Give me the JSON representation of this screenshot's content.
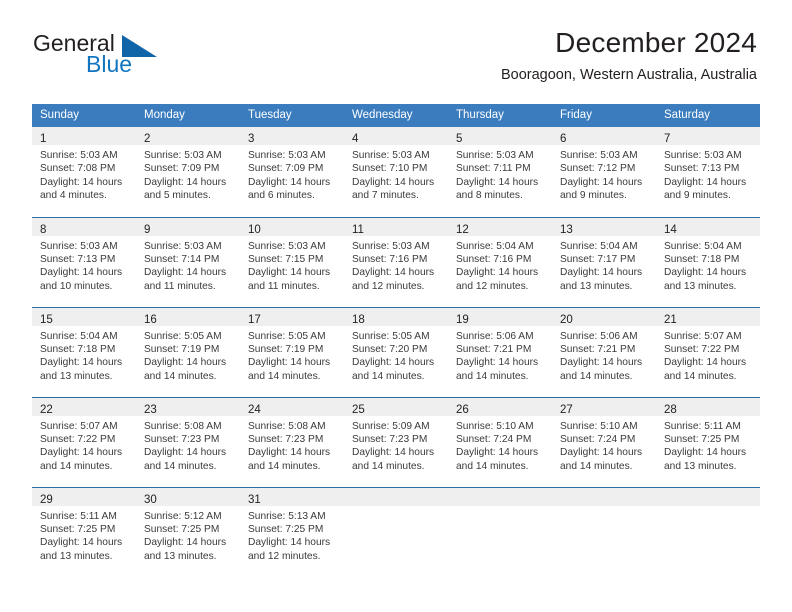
{
  "logo": {
    "word1": "General",
    "word2": "Blue",
    "triangle_color": "#1064a8",
    "blue_color": "#1175c0"
  },
  "header": {
    "title": "December 2024",
    "subtitle": "Booragoon, Western Australia, Australia"
  },
  "theme": {
    "header_blue": "#3a7cbe",
    "row_line": "#2e6ea8",
    "daynum_band": "#efefef",
    "text": "#231f20"
  },
  "weekday_headers": [
    "Sunday",
    "Monday",
    "Tuesday",
    "Wednesday",
    "Thursday",
    "Friday",
    "Saturday"
  ],
  "weeks": [
    [
      {
        "day": "1",
        "sunrise": "Sunrise: 5:03 AM",
        "sunset": "Sunset: 7:08 PM",
        "daylight1": "Daylight: 14 hours",
        "daylight2": "and 4 minutes."
      },
      {
        "day": "2",
        "sunrise": "Sunrise: 5:03 AM",
        "sunset": "Sunset: 7:09 PM",
        "daylight1": "Daylight: 14 hours",
        "daylight2": "and 5 minutes."
      },
      {
        "day": "3",
        "sunrise": "Sunrise: 5:03 AM",
        "sunset": "Sunset: 7:09 PM",
        "daylight1": "Daylight: 14 hours",
        "daylight2": "and 6 minutes."
      },
      {
        "day": "4",
        "sunrise": "Sunrise: 5:03 AM",
        "sunset": "Sunset: 7:10 PM",
        "daylight1": "Daylight: 14 hours",
        "daylight2": "and 7 minutes."
      },
      {
        "day": "5",
        "sunrise": "Sunrise: 5:03 AM",
        "sunset": "Sunset: 7:11 PM",
        "daylight1": "Daylight: 14 hours",
        "daylight2": "and 8 minutes."
      },
      {
        "day": "6",
        "sunrise": "Sunrise: 5:03 AM",
        "sunset": "Sunset: 7:12 PM",
        "daylight1": "Daylight: 14 hours",
        "daylight2": "and 9 minutes."
      },
      {
        "day": "7",
        "sunrise": "Sunrise: 5:03 AM",
        "sunset": "Sunset: 7:13 PM",
        "daylight1": "Daylight: 14 hours",
        "daylight2": "and 9 minutes."
      }
    ],
    [
      {
        "day": "8",
        "sunrise": "Sunrise: 5:03 AM",
        "sunset": "Sunset: 7:13 PM",
        "daylight1": "Daylight: 14 hours",
        "daylight2": "and 10 minutes."
      },
      {
        "day": "9",
        "sunrise": "Sunrise: 5:03 AM",
        "sunset": "Sunset: 7:14 PM",
        "daylight1": "Daylight: 14 hours",
        "daylight2": "and 11 minutes."
      },
      {
        "day": "10",
        "sunrise": "Sunrise: 5:03 AM",
        "sunset": "Sunset: 7:15 PM",
        "daylight1": "Daylight: 14 hours",
        "daylight2": "and 11 minutes."
      },
      {
        "day": "11",
        "sunrise": "Sunrise: 5:03 AM",
        "sunset": "Sunset: 7:16 PM",
        "daylight1": "Daylight: 14 hours",
        "daylight2": "and 12 minutes."
      },
      {
        "day": "12",
        "sunrise": "Sunrise: 5:04 AM",
        "sunset": "Sunset: 7:16 PM",
        "daylight1": "Daylight: 14 hours",
        "daylight2": "and 12 minutes."
      },
      {
        "day": "13",
        "sunrise": "Sunrise: 5:04 AM",
        "sunset": "Sunset: 7:17 PM",
        "daylight1": "Daylight: 14 hours",
        "daylight2": "and 13 minutes."
      },
      {
        "day": "14",
        "sunrise": "Sunrise: 5:04 AM",
        "sunset": "Sunset: 7:18 PM",
        "daylight1": "Daylight: 14 hours",
        "daylight2": "and 13 minutes."
      }
    ],
    [
      {
        "day": "15",
        "sunrise": "Sunrise: 5:04 AM",
        "sunset": "Sunset: 7:18 PM",
        "daylight1": "Daylight: 14 hours",
        "daylight2": "and 13 minutes."
      },
      {
        "day": "16",
        "sunrise": "Sunrise: 5:05 AM",
        "sunset": "Sunset: 7:19 PM",
        "daylight1": "Daylight: 14 hours",
        "daylight2": "and 14 minutes."
      },
      {
        "day": "17",
        "sunrise": "Sunrise: 5:05 AM",
        "sunset": "Sunset: 7:19 PM",
        "daylight1": "Daylight: 14 hours",
        "daylight2": "and 14 minutes."
      },
      {
        "day": "18",
        "sunrise": "Sunrise: 5:05 AM",
        "sunset": "Sunset: 7:20 PM",
        "daylight1": "Daylight: 14 hours",
        "daylight2": "and 14 minutes."
      },
      {
        "day": "19",
        "sunrise": "Sunrise: 5:06 AM",
        "sunset": "Sunset: 7:21 PM",
        "daylight1": "Daylight: 14 hours",
        "daylight2": "and 14 minutes."
      },
      {
        "day": "20",
        "sunrise": "Sunrise: 5:06 AM",
        "sunset": "Sunset: 7:21 PM",
        "daylight1": "Daylight: 14 hours",
        "daylight2": "and 14 minutes."
      },
      {
        "day": "21",
        "sunrise": "Sunrise: 5:07 AM",
        "sunset": "Sunset: 7:22 PM",
        "daylight1": "Daylight: 14 hours",
        "daylight2": "and 14 minutes."
      }
    ],
    [
      {
        "day": "22",
        "sunrise": "Sunrise: 5:07 AM",
        "sunset": "Sunset: 7:22 PM",
        "daylight1": "Daylight: 14 hours",
        "daylight2": "and 14 minutes."
      },
      {
        "day": "23",
        "sunrise": "Sunrise: 5:08 AM",
        "sunset": "Sunset: 7:23 PM",
        "daylight1": "Daylight: 14 hours",
        "daylight2": "and 14 minutes."
      },
      {
        "day": "24",
        "sunrise": "Sunrise: 5:08 AM",
        "sunset": "Sunset: 7:23 PM",
        "daylight1": "Daylight: 14 hours",
        "daylight2": "and 14 minutes."
      },
      {
        "day": "25",
        "sunrise": "Sunrise: 5:09 AM",
        "sunset": "Sunset: 7:23 PM",
        "daylight1": "Daylight: 14 hours",
        "daylight2": "and 14 minutes."
      },
      {
        "day": "26",
        "sunrise": "Sunrise: 5:10 AM",
        "sunset": "Sunset: 7:24 PM",
        "daylight1": "Daylight: 14 hours",
        "daylight2": "and 14 minutes."
      },
      {
        "day": "27",
        "sunrise": "Sunrise: 5:10 AM",
        "sunset": "Sunset: 7:24 PM",
        "daylight1": "Daylight: 14 hours",
        "daylight2": "and 14 minutes."
      },
      {
        "day": "28",
        "sunrise": "Sunrise: 5:11 AM",
        "sunset": "Sunset: 7:25 PM",
        "daylight1": "Daylight: 14 hours",
        "daylight2": "and 13 minutes."
      }
    ],
    [
      {
        "day": "29",
        "sunrise": "Sunrise: 5:11 AM",
        "sunset": "Sunset: 7:25 PM",
        "daylight1": "Daylight: 14 hours",
        "daylight2": "and 13 minutes."
      },
      {
        "day": "30",
        "sunrise": "Sunrise: 5:12 AM",
        "sunset": "Sunset: 7:25 PM",
        "daylight1": "Daylight: 14 hours",
        "daylight2": "and 13 minutes."
      },
      {
        "day": "31",
        "sunrise": "Sunrise: 5:13 AM",
        "sunset": "Sunset: 7:25 PM",
        "daylight1": "Daylight: 14 hours",
        "daylight2": "and 12 minutes."
      },
      {
        "day": "",
        "sunrise": "",
        "sunset": "",
        "daylight1": "",
        "daylight2": ""
      },
      {
        "day": "",
        "sunrise": "",
        "sunset": "",
        "daylight1": "",
        "daylight2": ""
      },
      {
        "day": "",
        "sunrise": "",
        "sunset": "",
        "daylight1": "",
        "daylight2": ""
      },
      {
        "day": "",
        "sunrise": "",
        "sunset": "",
        "daylight1": "",
        "daylight2": ""
      }
    ]
  ]
}
